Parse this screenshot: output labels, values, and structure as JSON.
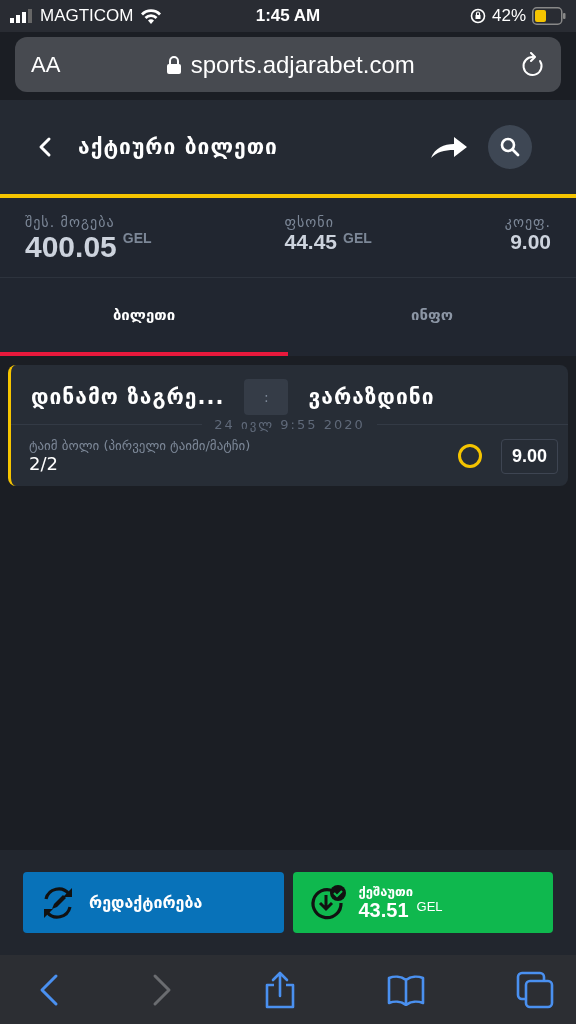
{
  "status_bar": {
    "carrier": "MAGTICOM",
    "time": "1:45 AM",
    "battery": "42%"
  },
  "browser": {
    "text_size_button": "AA",
    "url": "sports.adjarabet.com"
  },
  "header": {
    "title": "აქტიური ბილეთი"
  },
  "summary": [
    {
      "label": "შეს. მოგება",
      "value": "400.05",
      "currency": "GEL",
      "kind": "large"
    },
    {
      "label": "ფსონი",
      "value": "44.45",
      "currency": "GEL",
      "kind": "medium"
    },
    {
      "label": "კოეფ.",
      "value": "9.00",
      "kind": "right"
    }
  ],
  "tabs": [
    {
      "label": "ბილეთი",
      "selected": true
    },
    {
      "label": "ინფო",
      "selected": false
    }
  ],
  "bet": {
    "home": "დინამო ზაგრე...",
    "score": ":",
    "away": "ვარაზდინი",
    "date": "24 ივლ 9:55 2020",
    "market": "ტაიმ ბოლი (პირველი ტაიმი/მატჩი)",
    "selection": "2/2",
    "odds": "9.00"
  },
  "actions": [
    {
      "kind": "edit",
      "label": "რედაქტირება"
    },
    {
      "kind": "cashout",
      "label": "ქეშაუთი",
      "value": "43.51",
      "currency": "GEL"
    }
  ]
}
